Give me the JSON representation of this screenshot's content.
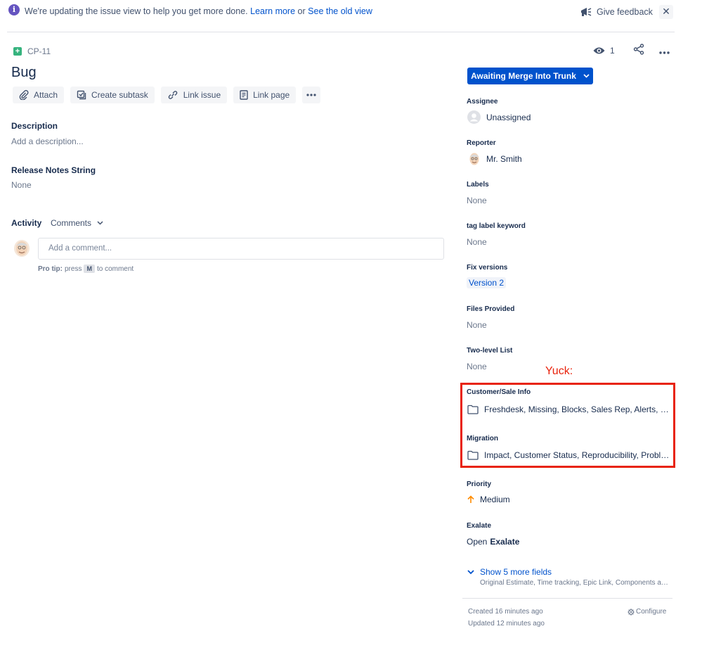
{
  "banner": {
    "text": "We're updating the issue view to help you get more done.",
    "learn_more": "Learn more",
    "or": "or",
    "old_view": "See the old view",
    "feedback": "Give feedback",
    "close_glyph": "✕"
  },
  "issue": {
    "key": "CP-11",
    "title": "Bug"
  },
  "toolbar": {
    "attach": "Attach",
    "create_subtask": "Create subtask",
    "link_issue": "Link issue",
    "link_page": "Link page"
  },
  "description": {
    "label": "Description",
    "placeholder": "Add a description..."
  },
  "release_notes": {
    "label": "Release Notes String",
    "value": "None"
  },
  "activity": {
    "label": "Activity",
    "filter": "Comments",
    "comment_placeholder": "Add a comment...",
    "protip_bold": "Pro tip:",
    "protip_press": "press",
    "protip_key": "M",
    "protip_rest": "to comment"
  },
  "watchers": {
    "count": "1"
  },
  "status": {
    "label": "Awaiting Merge Into Trunk"
  },
  "fields": {
    "assignee": {
      "label": "Assignee",
      "value": "Unassigned"
    },
    "reporter": {
      "label": "Reporter",
      "value": "Mr. Smith"
    },
    "labels": {
      "label": "Labels",
      "value": "None"
    },
    "tag_label": {
      "label": "tag label keyword",
      "value": "None"
    },
    "fix_versions": {
      "label": "Fix versions",
      "value": "Version 2"
    },
    "files_provided": {
      "label": "Files Provided",
      "value": "None"
    },
    "two_level": {
      "label": "Two-level List",
      "value": "None"
    },
    "customer_sale": {
      "label": "Customer/Sale Info",
      "value": "Freshdesk, Missing, Blocks, Sales Rep, Alerts, Next Steps"
    },
    "migration": {
      "label": "Migration",
      "value": "Impact, Customer Status, Reproducibility, Problem Area"
    },
    "priority": {
      "label": "Priority",
      "value": "Medium"
    },
    "exalate": {
      "label": "Exalate",
      "open": "Open",
      "name": "Exalate"
    }
  },
  "annotation": {
    "text": "Yuck:",
    "color": "#e8230c"
  },
  "more_fields": {
    "label": "Show 5 more fields",
    "sub": "Original Estimate, Time tracking, Epic Link, Components and Sprint"
  },
  "meta": {
    "created": "Created 16 minutes ago",
    "updated": "Updated 12 minutes ago",
    "configure": "Configure"
  },
  "colors": {
    "primary": "#0052cc",
    "story_icon": "#36b37e",
    "info_icon": "#6554c0",
    "priority_medium": "#ff8b00"
  }
}
